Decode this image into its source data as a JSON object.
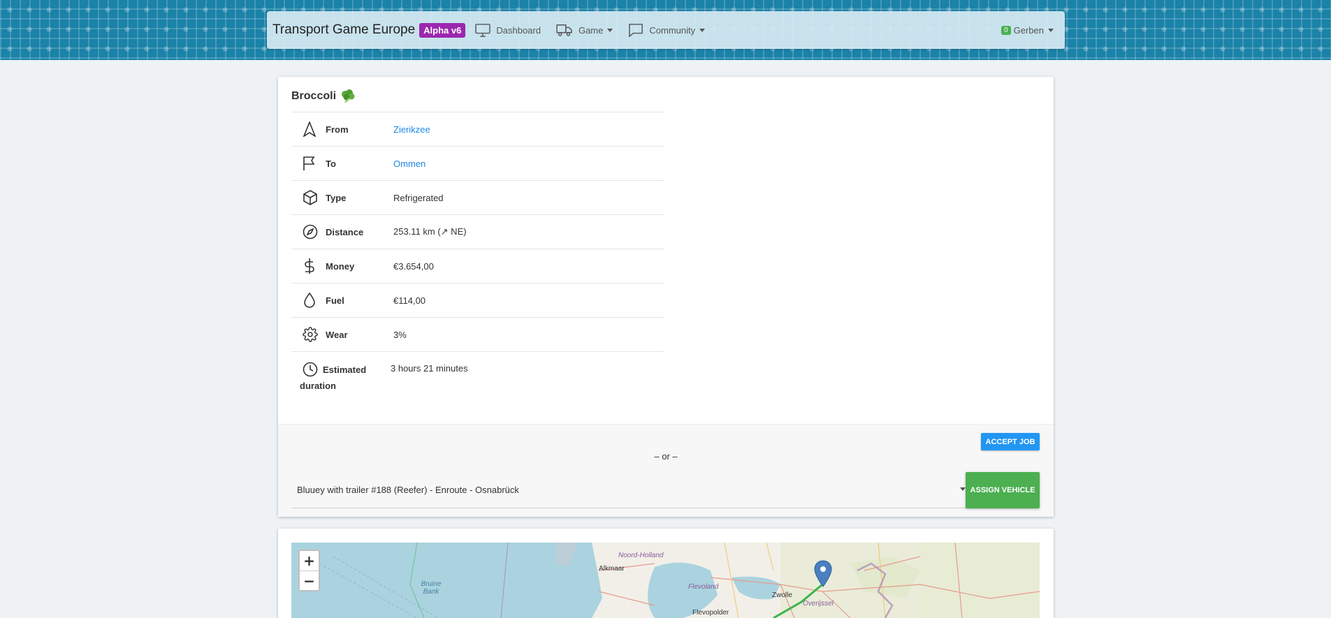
{
  "navbar": {
    "brand": "Transport Game Europe",
    "version_badge": "Alpha v6",
    "items": [
      {
        "label": "Dashboard"
      },
      {
        "label": "Game"
      },
      {
        "label": "Community"
      }
    ],
    "user": {
      "count": "0",
      "name": "Gerben"
    }
  },
  "job": {
    "title": "Broccoli",
    "rows": [
      {
        "icon": "navigation-arrow-icon",
        "label": "From",
        "value": "Zierikzee"
      },
      {
        "icon": "flag-icon",
        "label": "To",
        "value": "Ommen"
      },
      {
        "icon": "box-icon",
        "label": "Type",
        "value": "Refrigerated"
      },
      {
        "icon": "compass-icon",
        "label": "Distance",
        "value": "253.11 km (↗ NE)"
      },
      {
        "icon": "dollar-icon",
        "label": "Money",
        "value": "€3.654,00"
      },
      {
        "icon": "droplet-icon",
        "label": "Fuel",
        "value": "€114,00"
      },
      {
        "icon": "gear-icon",
        "label": "Wear",
        "value": "3%"
      },
      {
        "icon": "clock-icon",
        "label": "Estimated duration",
        "value": "3 hours 21 minutes"
      }
    ]
  },
  "actions": {
    "accept_label": "ACCEPT JOB",
    "or_text": "– or –",
    "vehicle_select_value": "Bluuey with trailer #188 (Reefer) - Enroute - Osnabrück",
    "assign_label": "ASSIGN VEHICLE"
  },
  "map": {
    "zoom_in": "+",
    "zoom_out": "−",
    "labels": [
      "Noord-Holland",
      "Alkmaar",
      "Flevoland",
      "Zwolle",
      "Overijssel",
      "Flevopolder",
      "Bruine Bank"
    ]
  }
}
